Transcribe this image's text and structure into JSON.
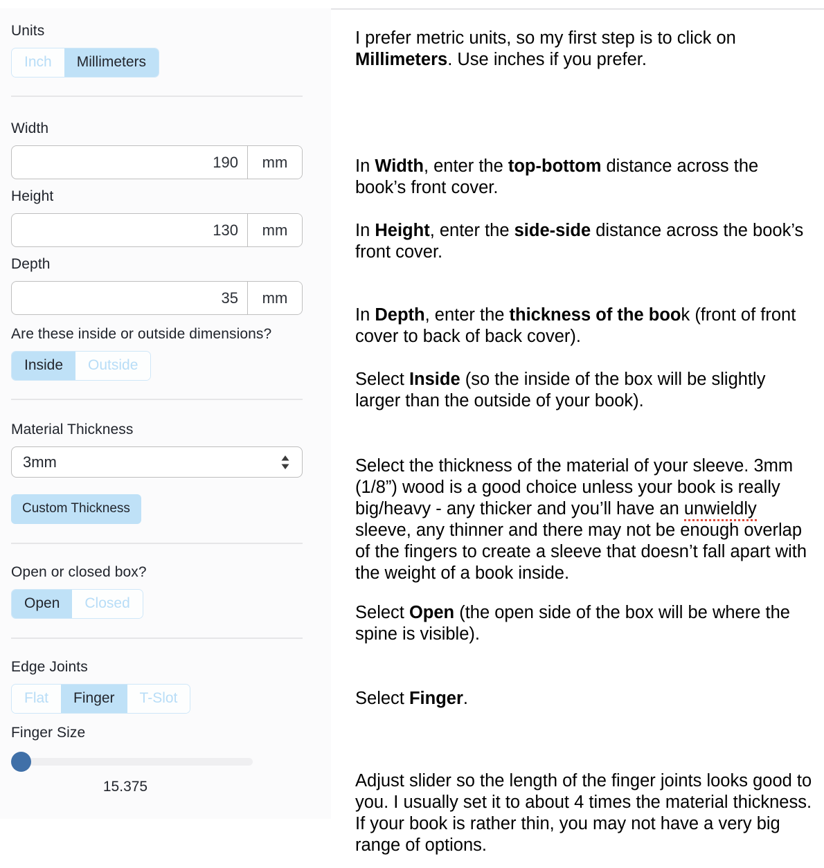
{
  "app": {
    "accent_selected_bg": "#bfe1f7",
    "accent_unselected_text": "#b8ddf7",
    "slider_thumb_color": "#4070a8",
    "panel_bg": "#fbfbfc"
  },
  "panel": {
    "units": {
      "label": "Units",
      "options": [
        "Inch",
        "Millimeters"
      ],
      "selected": "Millimeters"
    },
    "width": {
      "label": "Width",
      "value": "190",
      "unit": "mm"
    },
    "height": {
      "label": "Height",
      "value": "130",
      "unit": "mm"
    },
    "depth": {
      "label": "Depth",
      "value": "35",
      "unit": "mm"
    },
    "dimension_type": {
      "label": "Are these inside or outside dimensions?",
      "options": [
        "Inside",
        "Outside"
      ],
      "selected": "Inside"
    },
    "material_thickness": {
      "label": "Material Thickness",
      "selected": "3mm",
      "custom_button": "Custom Thickness"
    },
    "box_type": {
      "label": "Open or closed box?",
      "options": [
        "Open",
        "Closed"
      ],
      "selected": "Open"
    },
    "edge_joints": {
      "label": "Edge Joints",
      "options": [
        "Flat",
        "Finger",
        "T-Slot"
      ],
      "selected": "Finger"
    },
    "finger_size": {
      "label": "Finger Size",
      "value": "15.375"
    }
  },
  "notes": {
    "units": {
      "part1": "I prefer metric units, so my first step is to click on ",
      "bold1": "Millimeters",
      "part2": ".  Use inches if you prefer."
    },
    "width": {
      "part1": "In ",
      "bold1": "Width",
      "part2": ", enter the ",
      "bold2": "top-bottom",
      "part3": " distance across the book’s front cover."
    },
    "height": {
      "part1": "In ",
      "bold1": "Height",
      "part2": ", enter the ",
      "bold2": "side-side",
      "part3": " distance across the book’s front cover."
    },
    "depth": {
      "part1": "In ",
      "bold1": "Depth",
      "part2": ", enter the ",
      "bold2": "thickness of the boo",
      "part3": "k (front of front cover to back of back cover)."
    },
    "inside": {
      "part1": "Select ",
      "bold1": "Inside",
      "part2": " (so the inside of the box will be slightly larger than the outside of your book)."
    },
    "thickness": {
      "part1": "Select the thickness of the material of your sleeve. 3mm (1/8”) wood is a good choice unless your book is really big/heavy - any thicker and you’ll have an ",
      "misspelled": "unwieldly",
      "part2": " sleeve, any thinner and there may not be enough overlap of the fingers to create a sleeve that doesn’t fall apart with the weight of a book inside."
    },
    "open": {
      "part1": "Select ",
      "bold1": "Open",
      "part2": " (the open side of the box will be where the spine is visible)."
    },
    "finger": {
      "part1": "Select ",
      "bold1": "Finger",
      "part2": "."
    },
    "slider": {
      "part1": "Adjust slider so the length of the finger joints looks good to you.  I usually set it to about 4 times the material thickness.  If your book is rather thin, you may not have a very big range of options."
    }
  }
}
